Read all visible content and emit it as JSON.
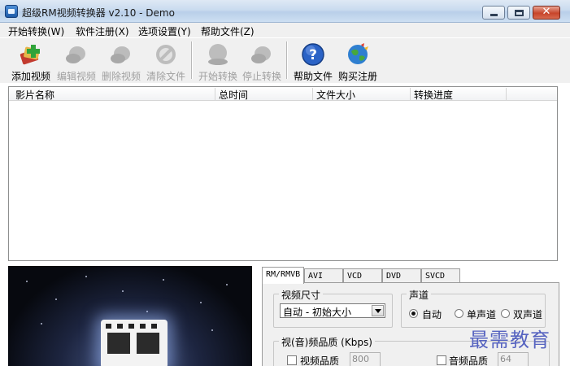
{
  "window": {
    "title": "超级RM视频转换器 v2.10 - Demo",
    "close_glyph": "✕"
  },
  "menu": [
    {
      "label": "开始转换(W)"
    },
    {
      "label": "软件注册(X)"
    },
    {
      "label": "选项设置(Y)"
    },
    {
      "label": "帮助文件(Z)"
    }
  ],
  "toolbar": [
    {
      "label": "添加视频",
      "icon": "add-video-icon",
      "enabled": true
    },
    {
      "label": "编辑视频",
      "icon": "edit-video-icon",
      "enabled": false
    },
    {
      "label": "删除视频",
      "icon": "delete-video-icon",
      "enabled": false
    },
    {
      "label": "清除文件",
      "icon": "clear-files-icon",
      "enabled": false
    },
    {
      "label": "开始转换",
      "icon": "start-convert-icon",
      "enabled": false
    },
    {
      "label": "停止转换",
      "icon": "stop-convert-icon",
      "enabled": false
    },
    {
      "label": "帮助文件",
      "icon": "help-icon",
      "enabled": true
    },
    {
      "label": "购买注册",
      "icon": "buy-register-icon",
      "enabled": true
    }
  ],
  "file_list": {
    "columns": [
      "影片名称",
      "总时间",
      "文件大小",
      "转换进度"
    ],
    "rows": []
  },
  "format_tabs": [
    {
      "label": "RM/RMVB",
      "active": true
    },
    {
      "label": "AVI",
      "active": false
    },
    {
      "label": "VCD",
      "active": false
    },
    {
      "label": "DVD",
      "active": false
    },
    {
      "label": "SVCD",
      "active": false
    }
  ],
  "settings": {
    "video_size": {
      "title": "视频尺寸",
      "selected": "自动 - 初始大小"
    },
    "channel": {
      "title": "声道",
      "options": [
        {
          "label": "自动",
          "checked": true
        },
        {
          "label": "单声道",
          "checked": false
        },
        {
          "label": "双声道",
          "checked": false
        }
      ]
    },
    "quality": {
      "title": "视(音)频品质 (Kbps)",
      "video": {
        "label": "视频品质",
        "checked": false,
        "value": "800"
      },
      "audio": {
        "label": "音频品质",
        "checked": false,
        "value": "64"
      }
    }
  },
  "watermark": "最需教育",
  "colors": {
    "accent": "#5663c0",
    "titlebar": "#c9dbef",
    "close_button": "#c7452b"
  }
}
